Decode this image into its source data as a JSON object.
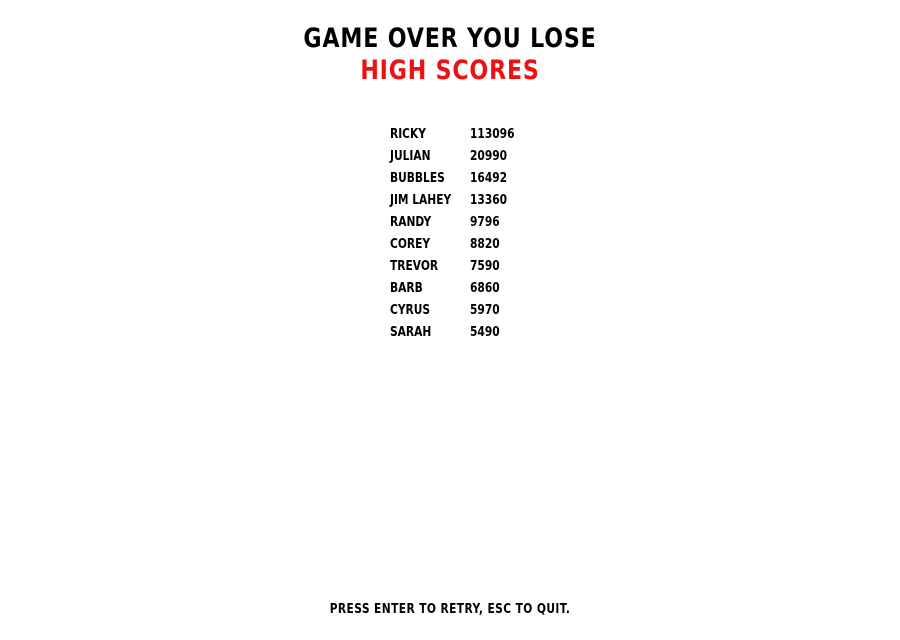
{
  "screen": {
    "title": "GAME OVER YOU LOSE",
    "subtitle": "HIGH SCORES",
    "footer": "PRESS ENTER TO RETRY, ESC TO QUIT."
  },
  "colors": {
    "background": "#ffffff",
    "title": "#000000",
    "subtitle": "#ee1111",
    "text": "#000000"
  },
  "high_scores": [
    {
      "name": "RICKY",
      "score": "113096"
    },
    {
      "name": "JULIAN",
      "score": "20990"
    },
    {
      "name": "BUBBLES",
      "score": "16492"
    },
    {
      "name": "JIM LAHEY",
      "score": "13360"
    },
    {
      "name": "RANDY",
      "score": "9796"
    },
    {
      "name": "COREY",
      "score": "8820"
    },
    {
      "name": "TREVOR",
      "score": "7590"
    },
    {
      "name": "BARB",
      "score": "6860"
    },
    {
      "name": "CYRUS",
      "score": "5970"
    },
    {
      "name": "SARAH",
      "score": "5490"
    }
  ]
}
